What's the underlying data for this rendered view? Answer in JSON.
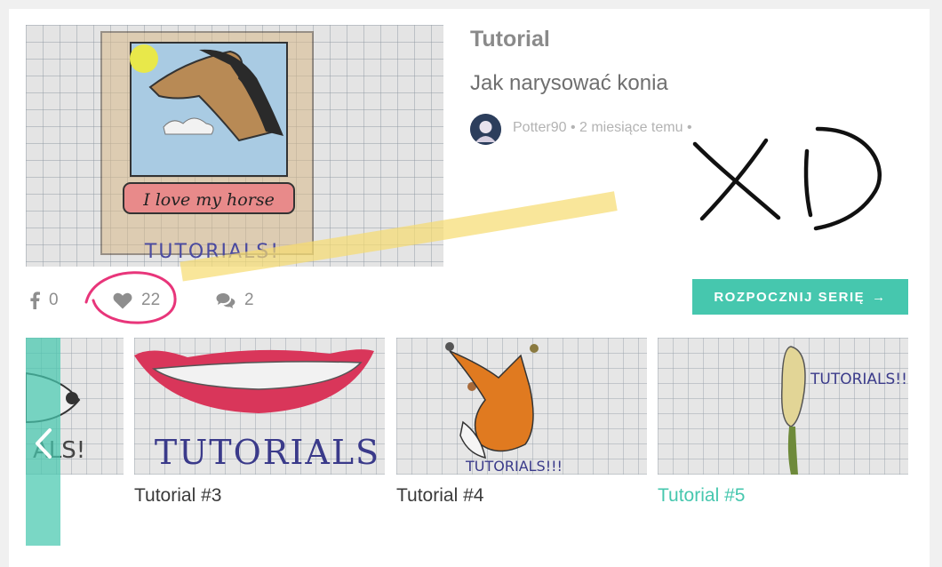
{
  "post": {
    "category": "Tutorial",
    "title": "Jak narysować konia",
    "author": "Potter90",
    "time_ago": "2 miesiące temu",
    "separator": "•"
  },
  "hero": {
    "drawing_text_banner": "I love my horse",
    "drawing_text_footer": "TUTORIALS!"
  },
  "stats": {
    "facebook_count": "0",
    "likes_count": "22",
    "comments_count": "2"
  },
  "start_series_button": {
    "label": "ROZPOCZNIJ SERIĘ",
    "arrow": "→"
  },
  "series": {
    "items": [
      {
        "label": "Tutorial #3",
        "thumb_text": "TUTORIALS",
        "active": false
      },
      {
        "label": "Tutorial #4",
        "thumb_text": "TUTORIALS!!!",
        "active": false
      },
      {
        "label": "Tutorial #5",
        "thumb_text": "TUTORIALS!!",
        "active": true
      }
    ],
    "partial_thumb_text": "ALS!"
  },
  "annotation": {
    "handwritten_text": "XD"
  },
  "colors": {
    "accent": "#46c7ae",
    "like_circle": "#e8357a",
    "highlighter": "#f7dc6f"
  },
  "icons": {
    "facebook": "facebook-icon",
    "like": "heart-icon",
    "comments": "comments-icon",
    "prev": "chevron-left-icon",
    "start_arrow": "arrow-right-icon"
  }
}
